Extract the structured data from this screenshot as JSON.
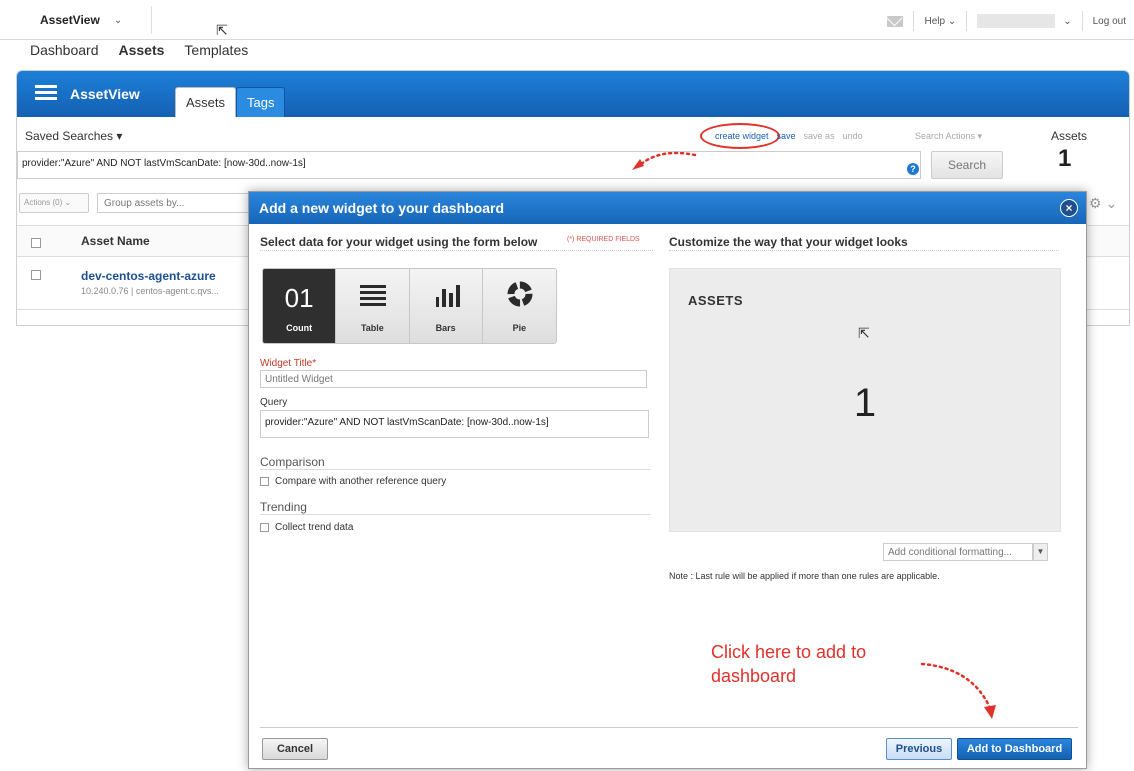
{
  "topbar": {
    "app_name": "AssetView",
    "help_label": "Help",
    "logout_label": "Log out"
  },
  "nav": [
    "Dashboard",
    "Assets",
    "Templates"
  ],
  "panel": {
    "title": "AssetView",
    "tabs": [
      "Assets",
      "Tags"
    ],
    "saved_searches": "Saved Searches",
    "links": {
      "create_widget": "create widget",
      "save": "save",
      "save_as": "save as",
      "undo": "undo"
    },
    "search_actions": "Search Actions",
    "assets_label": "Assets",
    "assets_count": "1",
    "query": "provider:\"Azure\" AND NOT lastVmScanDate: [now-30d..now-1s]",
    "search_button": "Search",
    "actions_label": "Actions (0)",
    "group_placeholder": "Group assets by...",
    "column_asset_name": "Asset Name",
    "row": {
      "name": "dev-centos-agent-azure",
      "sub": "10.240.0.76 | centos-agent.c.qvs..."
    }
  },
  "modal": {
    "title": "Add a new widget to your dashboard",
    "left_heading": "Select data for your widget using the form below",
    "required_note": "(*) REQUIRED FIELDS",
    "right_heading": "Customize the way that your widget looks",
    "types": [
      {
        "label": "Count",
        "value": "01"
      },
      {
        "label": "Table"
      },
      {
        "label": "Bars"
      },
      {
        "label": "Pie"
      }
    ],
    "widget_title_label": "Widget Title*",
    "widget_title_placeholder": "Untitled Widget",
    "query_label": "Query",
    "query_value": "provider:\"Azure\" AND NOT lastVmScanDate: [now-30d..now-1s]",
    "comparison_title": "Comparison",
    "comparison_checkbox": "Compare with another reference query",
    "trending_title": "Trending",
    "trending_checkbox": "Collect trend data",
    "preview_title": "ASSETS",
    "preview_count": "1",
    "cond_format_placeholder": "Add conditional formatting...",
    "note": "Note : Last rule will be applied if more than one rules are applicable.",
    "cancel": "Cancel",
    "previous": "Previous",
    "add_to_dashboard": "Add to Dashboard"
  },
  "annotation": {
    "line1": "Click here to add to",
    "line2": "dashboard",
    "color": "#e0312a"
  }
}
